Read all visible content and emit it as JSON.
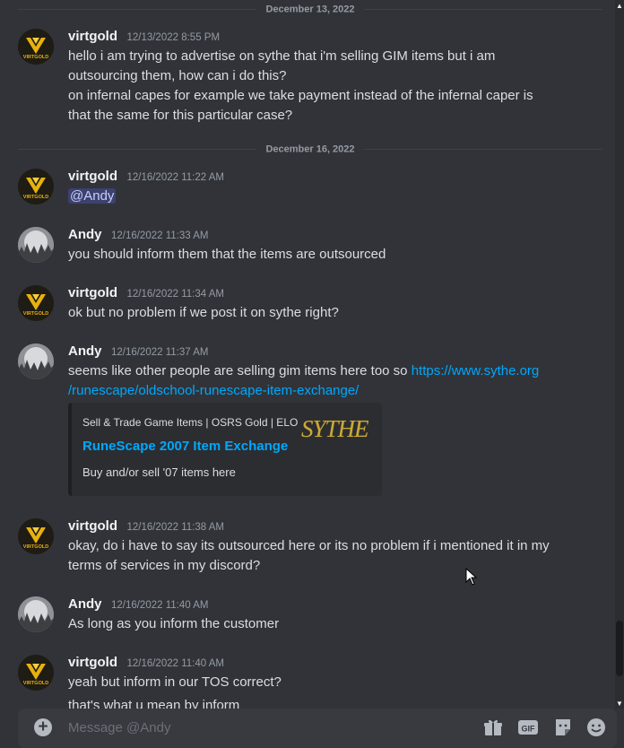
{
  "dividers": [
    "December 13, 2022",
    "December 16, 2022"
  ],
  "messages": [
    {
      "author": "virtgold",
      "timestamp": "12/13/2022 8:55 PM",
      "avatar": "virtgold-logo",
      "lines": [
        "hello i am trying to advertise on sythe that i'm selling GIM items but i am",
        "outsourcing them, how can i do this?",
        "on infernal capes for example we take payment instead of the infernal caper is",
        "that the same for this particular case?"
      ]
    },
    {
      "author": "virtgold",
      "timestamp": "12/16/2022 11:22 AM",
      "avatar": "virtgold-logo",
      "mention": "@Andy"
    },
    {
      "author": "Andy",
      "timestamp": "12/16/2022 11:33 AM",
      "avatar": "moon-forest",
      "lines": [
        "you should inform them that the items are outsourced"
      ]
    },
    {
      "author": "virtgold",
      "timestamp": "12/16/2022 11:34 AM",
      "avatar": "virtgold-logo",
      "lines": [
        "ok but no problem if we post it on sythe right?"
      ]
    },
    {
      "author": "Andy",
      "timestamp": "12/16/2022 11:37 AM",
      "avatar": "moon-forest",
      "text_before_link": "seems like other people are selling gim items here too so ",
      "link_part1": "https://www.sythe.org",
      "link_part2": "/runescape/oldschool-runescape-item-exchange/",
      "embed": {
        "provider": "Sell & Trade Game Items | OSRS Gold | ELO",
        "title": "RuneScape 2007 Item Exchange",
        "description": "Buy and/or sell '07 items here",
        "thumbnail_text": "SYTHE"
      }
    },
    {
      "author": "virtgold",
      "timestamp": "12/16/2022 11:38 AM",
      "avatar": "virtgold-logo",
      "lines": [
        "okay, do i have to say its outsourced here or its no problem if i mentioned it in my",
        "terms of services in my discord?"
      ]
    },
    {
      "author": "Andy",
      "timestamp": "12/16/2022 11:40 AM",
      "avatar": "moon-forest",
      "lines": [
        "As long as you inform the customer"
      ]
    },
    {
      "author": "virtgold",
      "timestamp": "12/16/2022 11:40 AM",
      "avatar": "virtgold-logo",
      "lines": [
        "yeah but inform in our TOS correct?",
        "that's what u mean by inform"
      ]
    }
  ],
  "composer": {
    "placeholder": "Message @Andy",
    "icons": [
      "plus-icon",
      "gift-icon",
      "gif-icon",
      "sticker-icon",
      "emoji-icon"
    ],
    "gif_label": "GIF"
  },
  "avatar_logo_text": "VIRTGOLD",
  "colors": {
    "background": "#313338",
    "link": "#00a8fc",
    "mention_bg": "#3c4270",
    "composer": "#383a40",
    "logo_gold": "#e8b10e"
  }
}
